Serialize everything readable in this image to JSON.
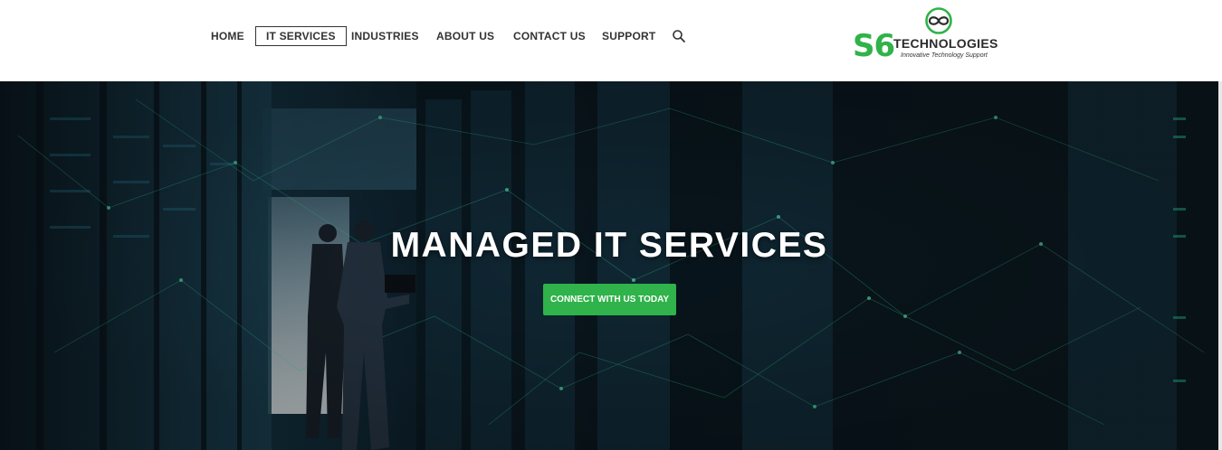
{
  "nav": {
    "items": [
      {
        "label": "HOME"
      },
      {
        "label": "IT SERVICES",
        "active": true
      },
      {
        "label": "INDUSTRIES"
      },
      {
        "label": "ABOUT US"
      },
      {
        "label": "CONTACT US"
      },
      {
        "label": "SUPPORT"
      }
    ],
    "search_icon": "search-icon"
  },
  "logo": {
    "mark": "S6",
    "name": "TECHNOLOGIES",
    "tagline": "Innovative Technology Support",
    "brand_color": "#2fb34a"
  },
  "hero": {
    "title": "MANAGED IT SERVICES",
    "cta_label": "CONNECT WITH US TODAY",
    "cta_color": "#2fb34a"
  }
}
